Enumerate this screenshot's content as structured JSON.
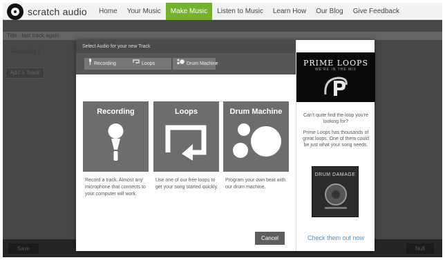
{
  "app": {
    "logo_text": "scratch audio",
    "title_text": "Title - last track again",
    "track_name": "Recording 1",
    "add_track_label": "Add a Track",
    "save_label": "Save",
    "right_label": "Null"
  },
  "nav": {
    "items": [
      {
        "label": "Home"
      },
      {
        "label": "Your Music"
      },
      {
        "label": "Make Music"
      },
      {
        "label": "Listen to Music"
      },
      {
        "label": "Learn How"
      },
      {
        "label": "Our Blog"
      },
      {
        "label": "Give Feedback"
      }
    ],
    "active_index": 2,
    "active_color": "#75b02f"
  },
  "modal": {
    "header": "Select Audio for your new Track",
    "tabs": [
      {
        "label": "Recording",
        "icon": "microphone-icon"
      },
      {
        "label": "Loops",
        "icon": "loop-icon"
      },
      {
        "label": "Drum Machine",
        "icon": "drum-icon"
      }
    ],
    "cards": [
      {
        "title": "Recording",
        "icon": "microphone-icon",
        "description": "Record a track. Almost any microphone that connects to your computer will work."
      },
      {
        "title": "Loops",
        "icon": "loop-icon",
        "description": "Use one of our free loops to get your song started quickly."
      },
      {
        "title": "Drum Machine",
        "icon": "drum-icon",
        "description": "Program your own beat with our drum machine."
      }
    ],
    "cancel_label": "Cancel"
  },
  "ad": {
    "brand": "PRIME LOOPS",
    "tagline": "WE'RE IN THE MIX",
    "text1": "Can't quite find the loop you're looking for?",
    "text2": "Prime Loops has thousands of great loops. One of them could be just what your song needs.",
    "product_title": "DRUM DAMAGE",
    "link_label": "Check them out now",
    "link_color": "#4a8fc9"
  }
}
